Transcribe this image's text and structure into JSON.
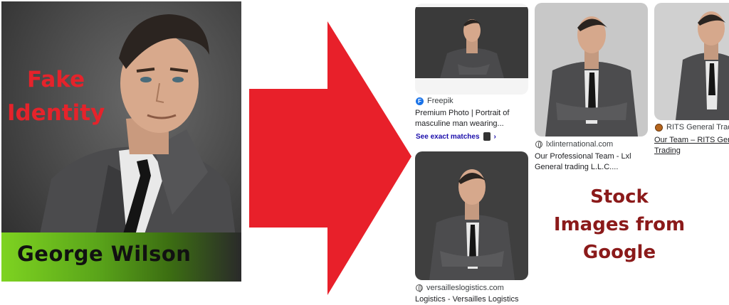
{
  "profile": {
    "label_line1": "Fake",
    "label_line2": "Identity",
    "name": "George Wilson"
  },
  "results": [
    {
      "source": "Freepik",
      "title_line1": "Premium Photo | Portrait of",
      "title_line2": "masculine man wearing...",
      "link": "See exact matches",
      "chevron": "›"
    },
    {
      "source": "lxlinternational.com",
      "title_line1": "Our Professional Team - Lxl",
      "title_line2": "General trading L.L.C...."
    },
    {
      "source": "RITS General Trad",
      "title_line1": "Our Team – RITS Gene",
      "title_line2": "Trading"
    },
    {
      "source": "versailleslogistics.com",
      "title_line1": "Logistics - Versailles Logistics"
    }
  ],
  "caption": {
    "line1": "Stock",
    "line2": "Images from",
    "line3": "Google"
  },
  "colors": {
    "label_red": "#e5232b",
    "arrow_red": "#e8202a",
    "caption_red": "#8b1a1a",
    "name_bar_green": "#7ed321",
    "link_blue": "#1a0dab"
  }
}
